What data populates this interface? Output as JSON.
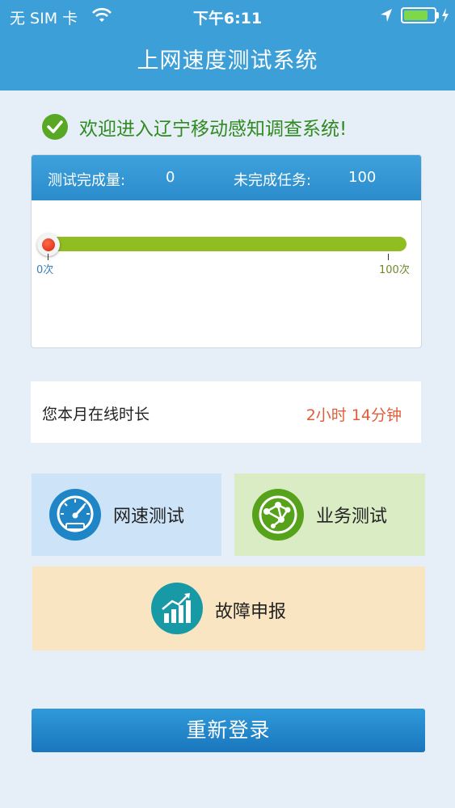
{
  "status_bar": {
    "carrier": "无 SIM 卡",
    "time": "下午6:11",
    "battery_level": 0.8
  },
  "nav": {
    "title": "上网速度测试系统"
  },
  "welcome": {
    "text": "欢迎进入辽宁移动感知调查系统!"
  },
  "progress": {
    "completed_label": "测试完成量:",
    "completed_value": "0",
    "remaining_label": "未完成任务:",
    "remaining_value": "100",
    "start_label": "0次",
    "end_label": "100次",
    "progress_fraction": 0
  },
  "online_time": {
    "label": "您本月在线时长",
    "value": "2小时 14分钟"
  },
  "tiles": {
    "speed_test": "网速测试",
    "service_test": "业务测试",
    "fault_report": "故障申报"
  },
  "relogin": {
    "label": "重新登录"
  },
  "colors": {
    "brand_blue": "#3d9fd8",
    "progress_green": "#8fbd22",
    "welcome_green": "#2f8a1f",
    "highlight_orange": "#e05d3a"
  }
}
